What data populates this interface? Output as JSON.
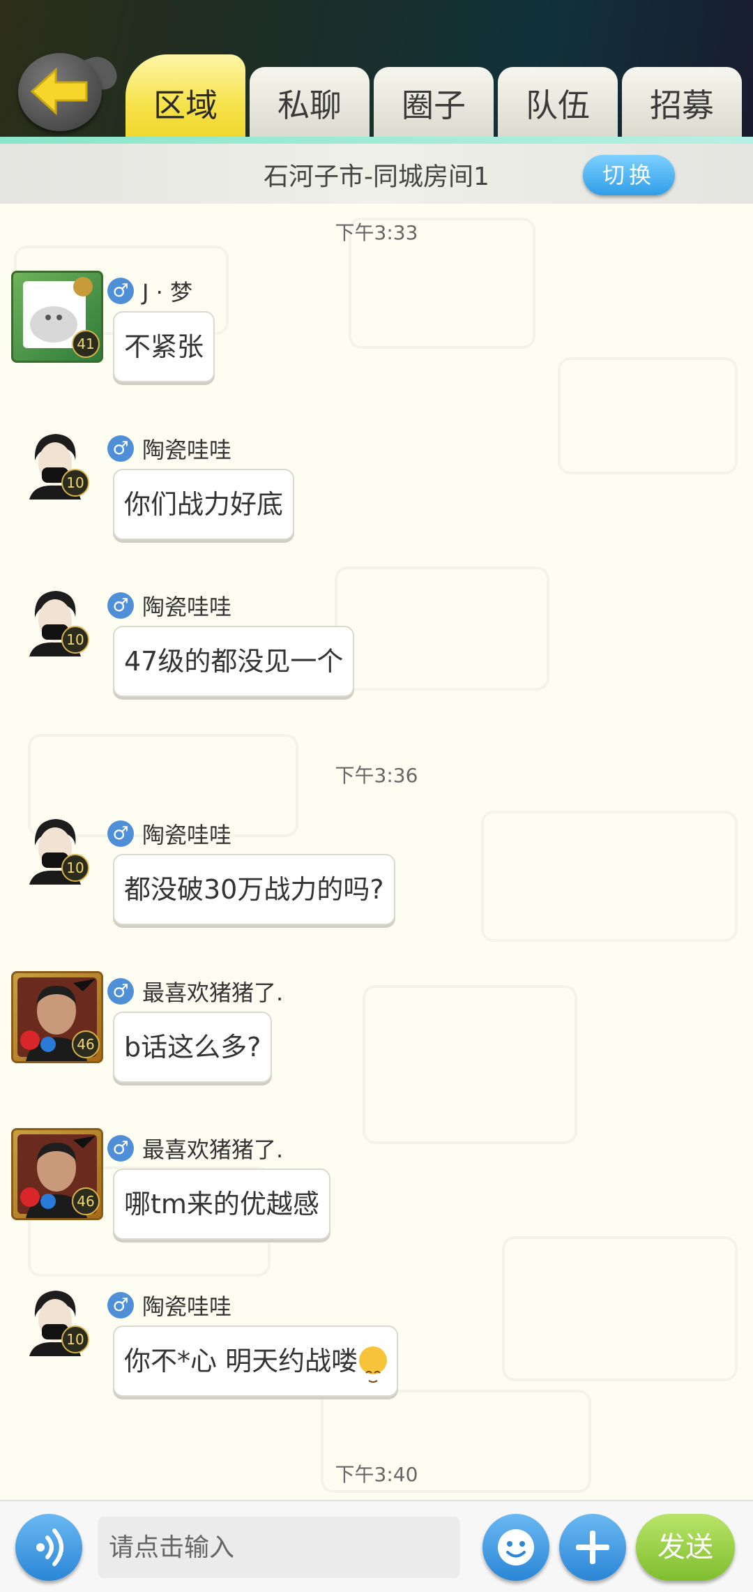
{
  "tabs": [
    {
      "label": "区域",
      "active": true
    },
    {
      "label": "私聊",
      "active": false
    },
    {
      "label": "圈子",
      "active": false
    },
    {
      "label": "队伍",
      "active": false
    },
    {
      "label": "招募",
      "active": false
    }
  ],
  "room": {
    "name": "石河子市-同城房间1",
    "switch_label": "切换"
  },
  "timestamps": [
    "下午3:33",
    "下午3:36",
    "下午3:40"
  ],
  "messages": [
    {
      "user": "J · 梦",
      "level": "41",
      "text": "不紧张",
      "gender_icon": "male-icon"
    },
    {
      "user": "陶瓷哇哇",
      "level": "10",
      "text": "你们战力好底",
      "gender_icon": "male-icon"
    },
    {
      "user": "陶瓷哇哇",
      "level": "10",
      "text": "47级的都没见一个",
      "gender_icon": "male-icon"
    },
    {
      "user": "陶瓷哇哇",
      "level": "10",
      "text": "都没破30万战力的吗?",
      "gender_icon": "male-icon"
    },
    {
      "user": "最喜欢猪猪了.",
      "level": "46",
      "text": "b话这么多?",
      "gender_icon": "male-icon"
    },
    {
      "user": "最喜欢猪猪了.",
      "level": "46",
      "text": "哪tm来的优越感",
      "gender_icon": "male-icon"
    },
    {
      "user": "陶瓷哇哇",
      "level": "10",
      "text": "你不*心   明天约战喽",
      "gender_icon": "male-icon",
      "trailing_emoji": "face-emoji-icon"
    }
  ],
  "input": {
    "placeholder": "请点击输入",
    "send_label": "发送"
  },
  "colors": {
    "active_tab": "#f6e24a",
    "accent_blue": "#2f9ee8",
    "send_green": "#7fbe2e"
  }
}
